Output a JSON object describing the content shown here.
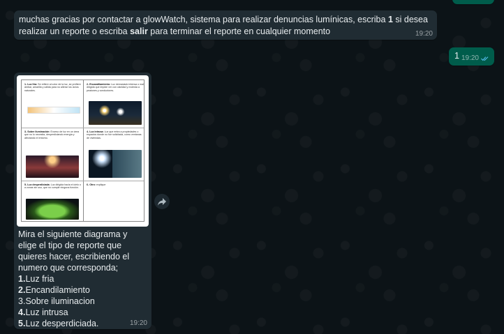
{
  "messages": {
    "intro": {
      "text": "muchas gracias por contactar a glowWatch, sistema para realizar denuncias lumínicas, escriba 1 si desea realizar un reporte o escriba salir para terminar el reporte en cualquier momento",
      "time": "19:20"
    },
    "reply": {
      "text": "1",
      "time": "19:20"
    },
    "menu": {
      "image": {
        "cells": [
          {
            "title": "1- Luz fría:",
            "body": "Se refiere al color de la luz, se prefiere ámbar, amarilla y cálida para no alterar los ciclos naturales."
          },
          {
            "title": "2- Encandilamiento:",
            "body": "Luz demasiado intensa o mal dirigida que impide ver con claridad y molesta a peatones y conductores."
          },
          {
            "title": "3- Sobre iluminación:",
            "body": "Exceso de luz en un área que no lo necesita, desperdiciando energía y afectando el entorno."
          },
          {
            "title": "4- Luz intrusa:",
            "body": "Luz que entra a propiedades o espacios donde no fue solicitada, como ventanas de viviendas."
          },
          {
            "title": "5- Luz desperdiciada:",
            "body": "Luz dirigida hacia el cielo o a zonas sin uso, que no cumple ninguna función."
          },
          {
            "title": "6- Otro:",
            "body": "explique"
          }
        ]
      },
      "intro": "Mira el siguiente diagrama y elige el tipo de reporte que quieres hacer, escribiendo el numero que corresponda;",
      "options": [
        {
          "num": "1.",
          "label": "Luz fria"
        },
        {
          "num": "2.",
          "label": "Encandilamiento"
        },
        {
          "num": "3.",
          "label": "Sobre iluminacion"
        },
        {
          "num": "4.",
          "label": "Luz intrusa"
        },
        {
          "num": "5.",
          "label": "Luz desperdiciada."
        }
      ],
      "time": "19:20"
    }
  },
  "icons": {
    "forward": "forward-arrow-icon",
    "read": "double-check-icon"
  },
  "colors": {
    "incoming": "#202c33",
    "outgoing": "#005c4b",
    "background": "#0c1317",
    "read_tick": "#53bdeb"
  }
}
